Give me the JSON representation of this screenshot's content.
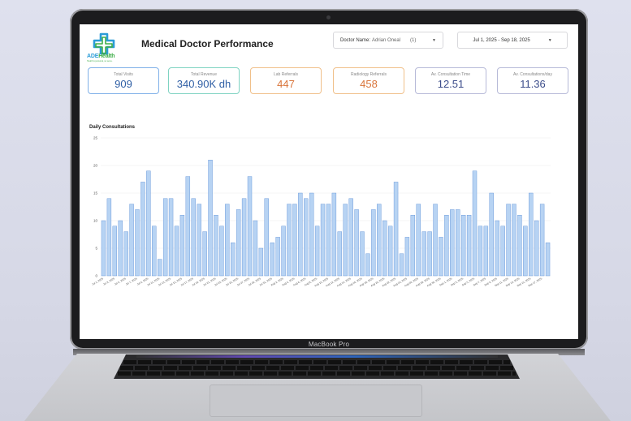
{
  "app": {
    "title": "Medical Doctor Performance",
    "logo_text_blue": "ADE",
    "logo_text_green": "Health",
    "logo_tagline": "Health is personal, so serve.",
    "device_label": "MacBook Pro"
  },
  "filters": {
    "doctor_label": "Doctor Name:",
    "doctor_value": "Adrian Oneal",
    "doctor_count": "(1)",
    "date_range": "Jul 1, 2025 - Sep 18, 2025"
  },
  "kpis": [
    {
      "label": "Total Visits",
      "value": "909",
      "border": "#7fb0e8",
      "color": "#2f5fa5"
    },
    {
      "label": "Total Revenue",
      "value": "340.90K dh",
      "border": "#7fd3c2",
      "color": "#2f5fa5"
    },
    {
      "label": "Lab Referrals",
      "value": "447",
      "border": "#f0c08a",
      "color": "#d9743a"
    },
    {
      "label": "Radiology Referrals",
      "value": "458",
      "border": "#f0c08a",
      "color": "#d9743a"
    },
    {
      "label": "Av. Consultation Time",
      "value": "12.51",
      "border": "#b7bad8",
      "color": "#3b4c8a"
    },
    {
      "label": "Av. Consultations/day",
      "value": "11.36",
      "border": "#b7bad8",
      "color": "#3b4c8a"
    }
  ],
  "colors": {
    "bar_fill": "#b7d3f3",
    "bar_stroke": "#5b8ed6"
  },
  "chart_data": {
    "type": "bar",
    "title": "Daily Consultations",
    "xlabel": "",
    "ylabel": "",
    "ylim": [
      0,
      25
    ],
    "yticks": [
      0,
      5,
      10,
      15,
      20,
      25
    ],
    "grid": true,
    "x_tick_labels": [
      "Jul 1, 2025",
      "Jul 3, 2025",
      "Jul 5, 2025",
      "Jul 7, 2025",
      "Jul 9, 2025",
      "Jul 11, 2025",
      "Jul 13, 2025",
      "Jul 15, 2025",
      "Jul 17, 2025",
      "Jul 19, 2025",
      "Jul 21, 2025",
      "Jul 23, 2025",
      "Jul 25, 2025",
      "Jul 27, 2025",
      "Jul 29, 2025",
      "Jul 31, 2025",
      "Aug 2, 2025",
      "Aug 4, 2025",
      "Aug 6, 2025",
      "Aug 8, 2025",
      "Aug 10, 2025",
      "Aug 12, 2025",
      "Aug 14, 2025",
      "Aug 16, 2025",
      "Aug 18, 2025",
      "Aug 20, 2025",
      "Aug 22, 2025",
      "Aug 24, 2025",
      "Aug 26, 2025",
      "Aug 28, 2025",
      "Aug 30, 2025",
      "Sep 1, 2025",
      "Sep 3, 2025",
      "Sep 5, 2025",
      "Sep 7, 2025",
      "Sep 9, 2025",
      "Sep 11, 2025",
      "Sep 13, 2025",
      "Sep 15, 2025",
      "Sep 17, 2025"
    ],
    "values": [
      10,
      14,
      9,
      10,
      8,
      13,
      12,
      17,
      19,
      9,
      3,
      14,
      14,
      9,
      11,
      18,
      14,
      13,
      8,
      21,
      11,
      9,
      13,
      6,
      12,
      14,
      18,
      10,
      5,
      14,
      6,
      7,
      9,
      13,
      13,
      15,
      14,
      15,
      9,
      13,
      13,
      15,
      8,
      13,
      14,
      12,
      8,
      4,
      12,
      13,
      10,
      9,
      17,
      4,
      7,
      11,
      13,
      8,
      8,
      13,
      7,
      11,
      12,
      12,
      11,
      11,
      19,
      9,
      9,
      15,
      10,
      9,
      13,
      13,
      11,
      9,
      15,
      10,
      13,
      6
    ]
  }
}
